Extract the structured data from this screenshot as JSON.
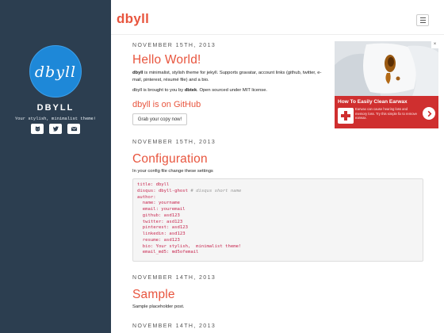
{
  "sidebar": {
    "logo_text": "dbyll",
    "site_name": "DBYLL",
    "tagline": "Your stylish, minimalist theme!",
    "social_icons": [
      "github-icon",
      "twitter-icon",
      "email-icon"
    ]
  },
  "header": {
    "brand": "dbyll",
    "menu_icon": "hamburger-icon"
  },
  "posts": [
    {
      "date": "NOVEMBER 15TH, 2013",
      "title": "Hello World!",
      "p1_bold": "dbyll",
      "p1_text": " is minimalist, stylish theme for jekyll. Supports gravatar, account links (github, twitter, e-mail, pinterest, résumé file) and a bio.",
      "p2_pre": "dbyll is brought to you by ",
      "p2_bold": "dbtek",
      "p2_post": ". Open sourced under MIT license.",
      "subheading": "dbyll is on GitHub",
      "button": "Grab your copy now!"
    },
    {
      "date": "NOVEMBER 15TH, 2013",
      "title": "Configuration",
      "intro": "In your config file change these settings",
      "code_lines": [
        "title: dbyll",
        "disqus: dbyll-ghost",
        "author:",
        "  name: yourname",
        "  email: youremail",
        "  github: asd123",
        "  twitter: asd123",
        "  pinterest: asd123",
        "  linkedin: asd123",
        "  resume: asd123",
        "  bio: Your stylish,  minimalist theme!",
        "  email_md5: md5ofemail"
      ],
      "code_comment": " # disqus short name"
    },
    {
      "date": "NOVEMBER 14TH, 2013",
      "title": "Sample",
      "text": "Sample placeholder post."
    },
    {
      "date": "NOVEMBER 14TH, 2013"
    }
  ],
  "ad": {
    "title": "How To Easily Clean Earwax",
    "description": "Earwax can cause hearing loss and memory loss. Try this simple fix to remove earwax.",
    "close_label": "×",
    "colors": {
      "accent": "#cf2f2f"
    }
  },
  "colors": {
    "sidebar_bg": "#2c3e50",
    "accent": "#e8553e",
    "logo_bg": "#1e88d8"
  }
}
